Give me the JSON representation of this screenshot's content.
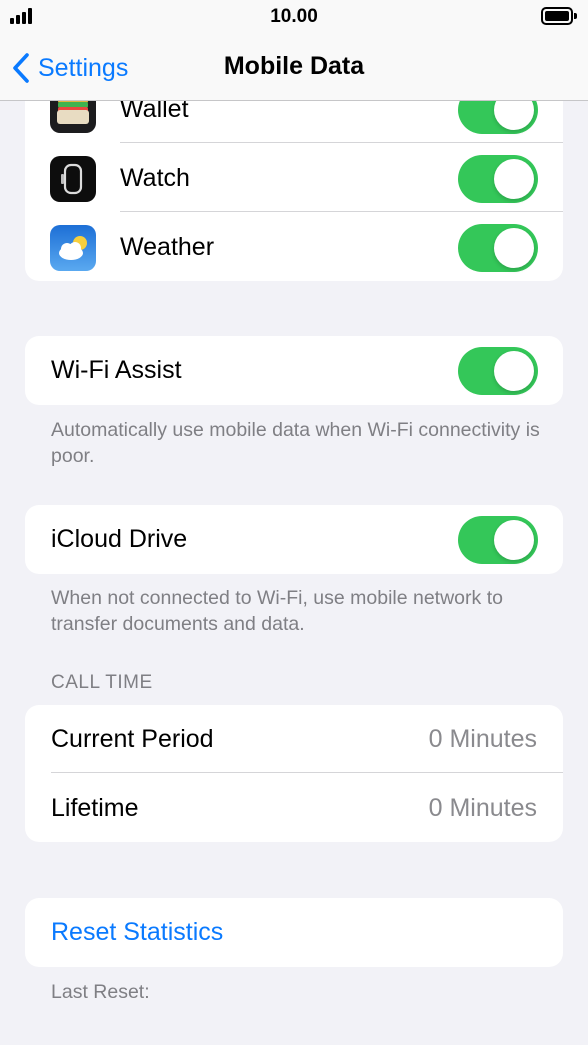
{
  "status_bar": {
    "time": "10.00"
  },
  "nav": {
    "back_label": "Settings",
    "title": "Mobile Data"
  },
  "apps": [
    {
      "label": "Wallet",
      "icon": "wallet-icon",
      "enabled": true
    },
    {
      "label": "Watch",
      "icon": "watch-icon",
      "enabled": true
    },
    {
      "label": "Weather",
      "icon": "weather-icon",
      "enabled": true
    }
  ],
  "wifi_assist": {
    "label": "Wi-Fi Assist",
    "enabled": true,
    "footer": "Automatically use mobile data when Wi-Fi connectivity is poor."
  },
  "icloud_drive": {
    "label": "iCloud Drive",
    "enabled": true,
    "footer": "When not connected to Wi-Fi, use mobile network to transfer documents and data."
  },
  "call_time": {
    "header": "CALL TIME",
    "rows": [
      {
        "label": "Current Period",
        "value": "0 Minutes"
      },
      {
        "label": "Lifetime",
        "value": "0 Minutes"
      }
    ]
  },
  "reset": {
    "label": "Reset Statistics",
    "last_reset_label": "Last Reset:"
  },
  "colors": {
    "accent": "#0a7aff",
    "toggle_on": "#34c759",
    "background": "#f2f2f7"
  }
}
